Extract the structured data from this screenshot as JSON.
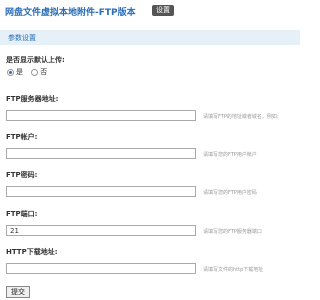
{
  "header": {
    "title": "网盘文件虚拟本地附件-FTP版本",
    "settings_button": "设置"
  },
  "section": {
    "title": "参数设置"
  },
  "default_upload": {
    "label": "是否显示默认上传:",
    "options": [
      "是",
      "否"
    ],
    "selected": "是"
  },
  "fields": [
    {
      "label": "FTP服务器地址:",
      "value": "",
      "hint": "请填写FTP的地址或者域名，例如:"
    },
    {
      "label": "FTP帐户:",
      "value": "",
      "hint": "请填写您的FTP用户帐户"
    },
    {
      "label": "FTP密码:",
      "value": "",
      "hint": "请填写您的FTP用户密码"
    },
    {
      "label": "FTP端口:",
      "value": "21",
      "hint": "请填写您的FTP服务器端口"
    },
    {
      "label": "HTTP下载地址:",
      "value": "",
      "hint": "请填写文件的http下载地址"
    }
  ],
  "submit_label": "提交",
  "colors": {
    "accent": "#2a6db5",
    "section_bg": "#e6f0f8"
  }
}
